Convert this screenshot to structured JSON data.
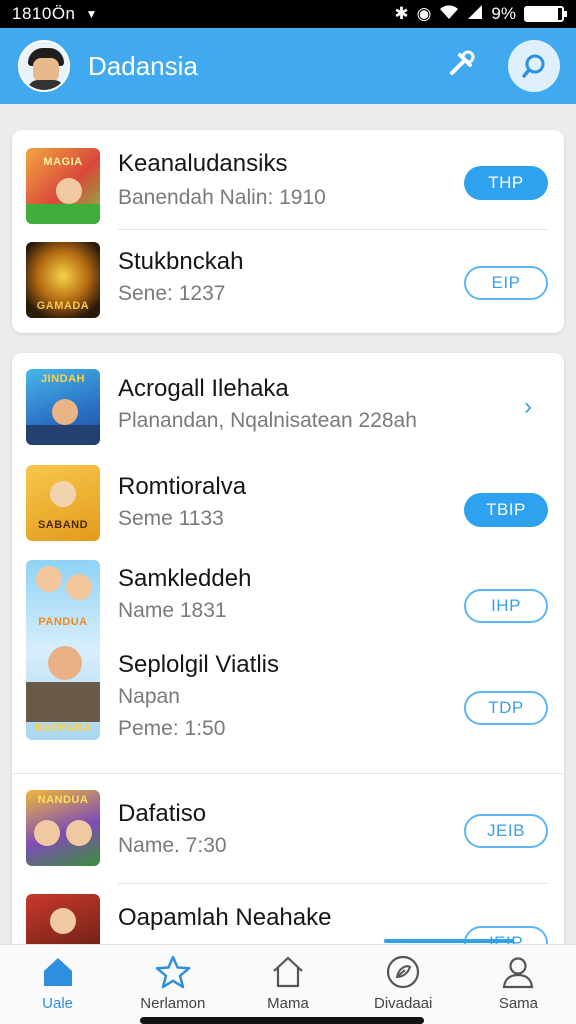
{
  "status_bar": {
    "time": "1810Ön",
    "battery": "9%"
  },
  "app_bar": {
    "title": "Dadansia",
    "actions": [
      "tools-icon",
      "search-icon"
    ]
  },
  "cards": [
    {
      "items": [
        {
          "title": "Keanaludansiks",
          "subtitle": "Banendah Nalin: 1910",
          "button": {
            "label": "THP",
            "style": "filled"
          }
        },
        {
          "title": "Stukbnckah",
          "subtitle": "Sene: 1237",
          "button": {
            "label": "EIP",
            "style": "outline"
          }
        }
      ]
    },
    {
      "items": [
        {
          "title": "Acrogall Ilehaka",
          "subtitle": "Planandan, Nqalnisatean 228ah",
          "action": "chevron"
        },
        {
          "title": "Romtioralva",
          "subtitle": "Seme 1133",
          "button": {
            "label": "TBIP",
            "style": "filled"
          }
        },
        {
          "title": "Samkleddeh",
          "subtitle": "Name 1831",
          "button": {
            "label": "IHP",
            "style": "outline"
          }
        },
        {
          "title": "Seplolgil Viatlis",
          "subtitle": "Napan",
          "subtitle2": "Peme: 1:50",
          "button": {
            "label": "TDP",
            "style": "outline"
          }
        },
        {
          "title": "Dafatiso",
          "subtitle": "Name. 7:30",
          "button": {
            "label": "JEIB",
            "style": "outline"
          }
        },
        {
          "title": "Oapamlah Neahake",
          "subtitle": "",
          "button": {
            "label": "IEIP",
            "style": "outline"
          }
        }
      ]
    }
  ],
  "bottom_nav": [
    {
      "label": "Uale",
      "icon": "home-icon",
      "active": true
    },
    {
      "label": "Nerlamon",
      "icon": "star-icon",
      "active": false
    },
    {
      "label": "Mama",
      "icon": "house-outline-icon",
      "active": false
    },
    {
      "label": "Divadaai",
      "icon": "leaf-circle-icon",
      "active": false
    },
    {
      "label": "Sama",
      "icon": "person-icon",
      "active": false
    }
  ],
  "colors": {
    "accent": "#41a9f0",
    "button": "#2ea1ef",
    "card": "#ffffff",
    "background": "#ececec"
  }
}
